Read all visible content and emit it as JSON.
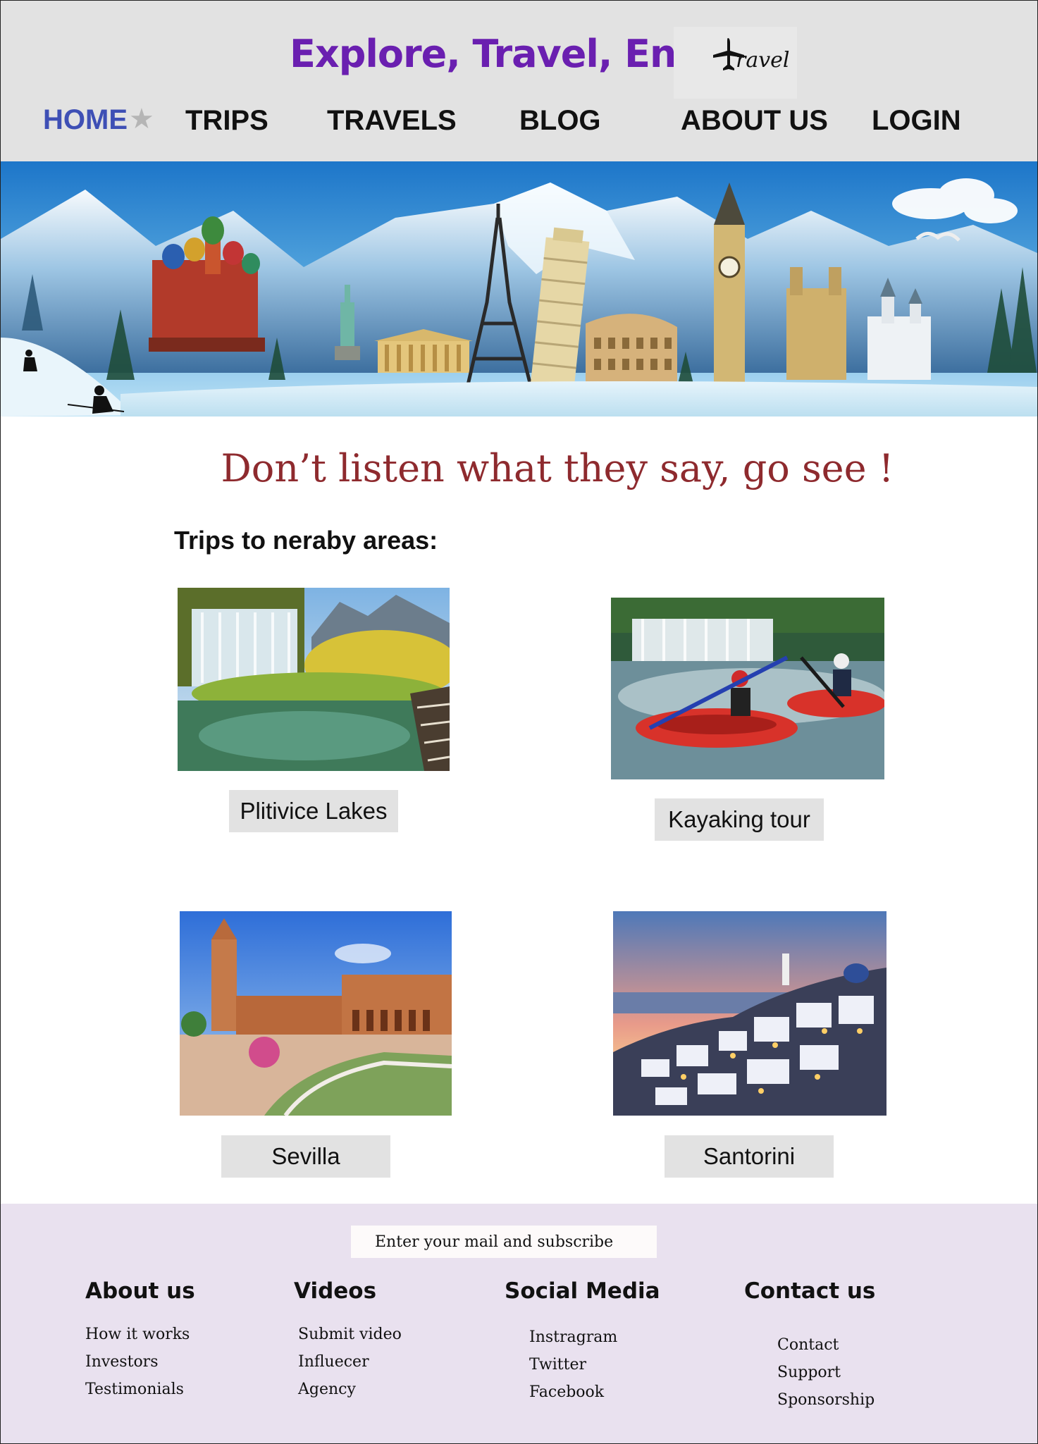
{
  "header": {
    "title": "Explore, Travel, Enjoy",
    "logo_text": "ravel"
  },
  "nav": {
    "items": [
      "HOME",
      "TRIPS",
      "TRAVELS",
      "BLOG",
      "ABOUT US",
      "LOGIN"
    ],
    "active": "HOME",
    "active_color": "#3e4fb5"
  },
  "banner": {
    "icons": [
      "cathedral",
      "statue-of-liberty",
      "parthenon",
      "eiffel-tower",
      "leaning-tower",
      "colosseum",
      "big-ben",
      "westminster",
      "castle",
      "skier",
      "seagull"
    ]
  },
  "main": {
    "tagline": "Don’t listen what they say, go see !",
    "section_heading": "Trips to neraby areas:",
    "trips": [
      {
        "label": "Plitivice Lakes"
      },
      {
        "label": "Kayaking tour"
      },
      {
        "label": "Sevilla"
      },
      {
        "label": "Santorini"
      }
    ]
  },
  "footer": {
    "subscribe_placeholder": "Enter your mail and subscribe",
    "columns": [
      {
        "heading": "About us",
        "links": [
          "How it works",
          "Investors",
          "Testimonials"
        ]
      },
      {
        "heading": "Videos",
        "links": [
          "Submit video",
          "Influecer",
          "Agency"
        ]
      },
      {
        "heading": "Social Media",
        "links": [
          "Instragram",
          "Twitter",
          "Facebook"
        ]
      },
      {
        "heading": "Contact us",
        "links": [
          "Contact",
          "Support",
          "Sponsorship"
        ]
      }
    ]
  },
  "colors": {
    "header_bg": "#e2e2e2",
    "title": "#6a1fb0",
    "tagline": "#8e2a2e",
    "footer_bg": "#e9e1ef"
  }
}
